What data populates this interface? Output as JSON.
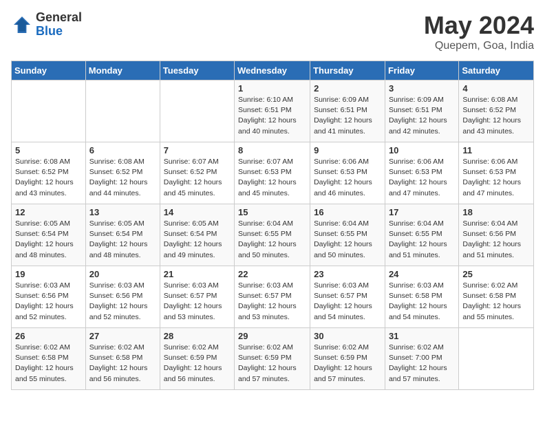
{
  "logo": {
    "general": "General",
    "blue": "Blue"
  },
  "title": "May 2024",
  "location": "Quepem, Goa, India",
  "days_of_week": [
    "Sunday",
    "Monday",
    "Tuesday",
    "Wednesday",
    "Thursday",
    "Friday",
    "Saturday"
  ],
  "weeks": [
    [
      {
        "day": "",
        "info": ""
      },
      {
        "day": "",
        "info": ""
      },
      {
        "day": "",
        "info": ""
      },
      {
        "day": "1",
        "info": "Sunrise: 6:10 AM\nSunset: 6:51 PM\nDaylight: 12 hours\nand 40 minutes."
      },
      {
        "day": "2",
        "info": "Sunrise: 6:09 AM\nSunset: 6:51 PM\nDaylight: 12 hours\nand 41 minutes."
      },
      {
        "day": "3",
        "info": "Sunrise: 6:09 AM\nSunset: 6:51 PM\nDaylight: 12 hours\nand 42 minutes."
      },
      {
        "day": "4",
        "info": "Sunrise: 6:08 AM\nSunset: 6:52 PM\nDaylight: 12 hours\nand 43 minutes."
      }
    ],
    [
      {
        "day": "5",
        "info": "Sunrise: 6:08 AM\nSunset: 6:52 PM\nDaylight: 12 hours\nand 43 minutes."
      },
      {
        "day": "6",
        "info": "Sunrise: 6:08 AM\nSunset: 6:52 PM\nDaylight: 12 hours\nand 44 minutes."
      },
      {
        "day": "7",
        "info": "Sunrise: 6:07 AM\nSunset: 6:52 PM\nDaylight: 12 hours\nand 45 minutes."
      },
      {
        "day": "8",
        "info": "Sunrise: 6:07 AM\nSunset: 6:53 PM\nDaylight: 12 hours\nand 45 minutes."
      },
      {
        "day": "9",
        "info": "Sunrise: 6:06 AM\nSunset: 6:53 PM\nDaylight: 12 hours\nand 46 minutes."
      },
      {
        "day": "10",
        "info": "Sunrise: 6:06 AM\nSunset: 6:53 PM\nDaylight: 12 hours\nand 47 minutes."
      },
      {
        "day": "11",
        "info": "Sunrise: 6:06 AM\nSunset: 6:53 PM\nDaylight: 12 hours\nand 47 minutes."
      }
    ],
    [
      {
        "day": "12",
        "info": "Sunrise: 6:05 AM\nSunset: 6:54 PM\nDaylight: 12 hours\nand 48 minutes."
      },
      {
        "day": "13",
        "info": "Sunrise: 6:05 AM\nSunset: 6:54 PM\nDaylight: 12 hours\nand 48 minutes."
      },
      {
        "day": "14",
        "info": "Sunrise: 6:05 AM\nSunset: 6:54 PM\nDaylight: 12 hours\nand 49 minutes."
      },
      {
        "day": "15",
        "info": "Sunrise: 6:04 AM\nSunset: 6:55 PM\nDaylight: 12 hours\nand 50 minutes."
      },
      {
        "day": "16",
        "info": "Sunrise: 6:04 AM\nSunset: 6:55 PM\nDaylight: 12 hours\nand 50 minutes."
      },
      {
        "day": "17",
        "info": "Sunrise: 6:04 AM\nSunset: 6:55 PM\nDaylight: 12 hours\nand 51 minutes."
      },
      {
        "day": "18",
        "info": "Sunrise: 6:04 AM\nSunset: 6:56 PM\nDaylight: 12 hours\nand 51 minutes."
      }
    ],
    [
      {
        "day": "19",
        "info": "Sunrise: 6:03 AM\nSunset: 6:56 PM\nDaylight: 12 hours\nand 52 minutes."
      },
      {
        "day": "20",
        "info": "Sunrise: 6:03 AM\nSunset: 6:56 PM\nDaylight: 12 hours\nand 52 minutes."
      },
      {
        "day": "21",
        "info": "Sunrise: 6:03 AM\nSunset: 6:57 PM\nDaylight: 12 hours\nand 53 minutes."
      },
      {
        "day": "22",
        "info": "Sunrise: 6:03 AM\nSunset: 6:57 PM\nDaylight: 12 hours\nand 53 minutes."
      },
      {
        "day": "23",
        "info": "Sunrise: 6:03 AM\nSunset: 6:57 PM\nDaylight: 12 hours\nand 54 minutes."
      },
      {
        "day": "24",
        "info": "Sunrise: 6:03 AM\nSunset: 6:58 PM\nDaylight: 12 hours\nand 54 minutes."
      },
      {
        "day": "25",
        "info": "Sunrise: 6:02 AM\nSunset: 6:58 PM\nDaylight: 12 hours\nand 55 minutes."
      }
    ],
    [
      {
        "day": "26",
        "info": "Sunrise: 6:02 AM\nSunset: 6:58 PM\nDaylight: 12 hours\nand 55 minutes."
      },
      {
        "day": "27",
        "info": "Sunrise: 6:02 AM\nSunset: 6:58 PM\nDaylight: 12 hours\nand 56 minutes."
      },
      {
        "day": "28",
        "info": "Sunrise: 6:02 AM\nSunset: 6:59 PM\nDaylight: 12 hours\nand 56 minutes."
      },
      {
        "day": "29",
        "info": "Sunrise: 6:02 AM\nSunset: 6:59 PM\nDaylight: 12 hours\nand 57 minutes."
      },
      {
        "day": "30",
        "info": "Sunrise: 6:02 AM\nSunset: 6:59 PM\nDaylight: 12 hours\nand 57 minutes."
      },
      {
        "day": "31",
        "info": "Sunrise: 6:02 AM\nSunset: 7:00 PM\nDaylight: 12 hours\nand 57 minutes."
      },
      {
        "day": "",
        "info": ""
      }
    ]
  ]
}
